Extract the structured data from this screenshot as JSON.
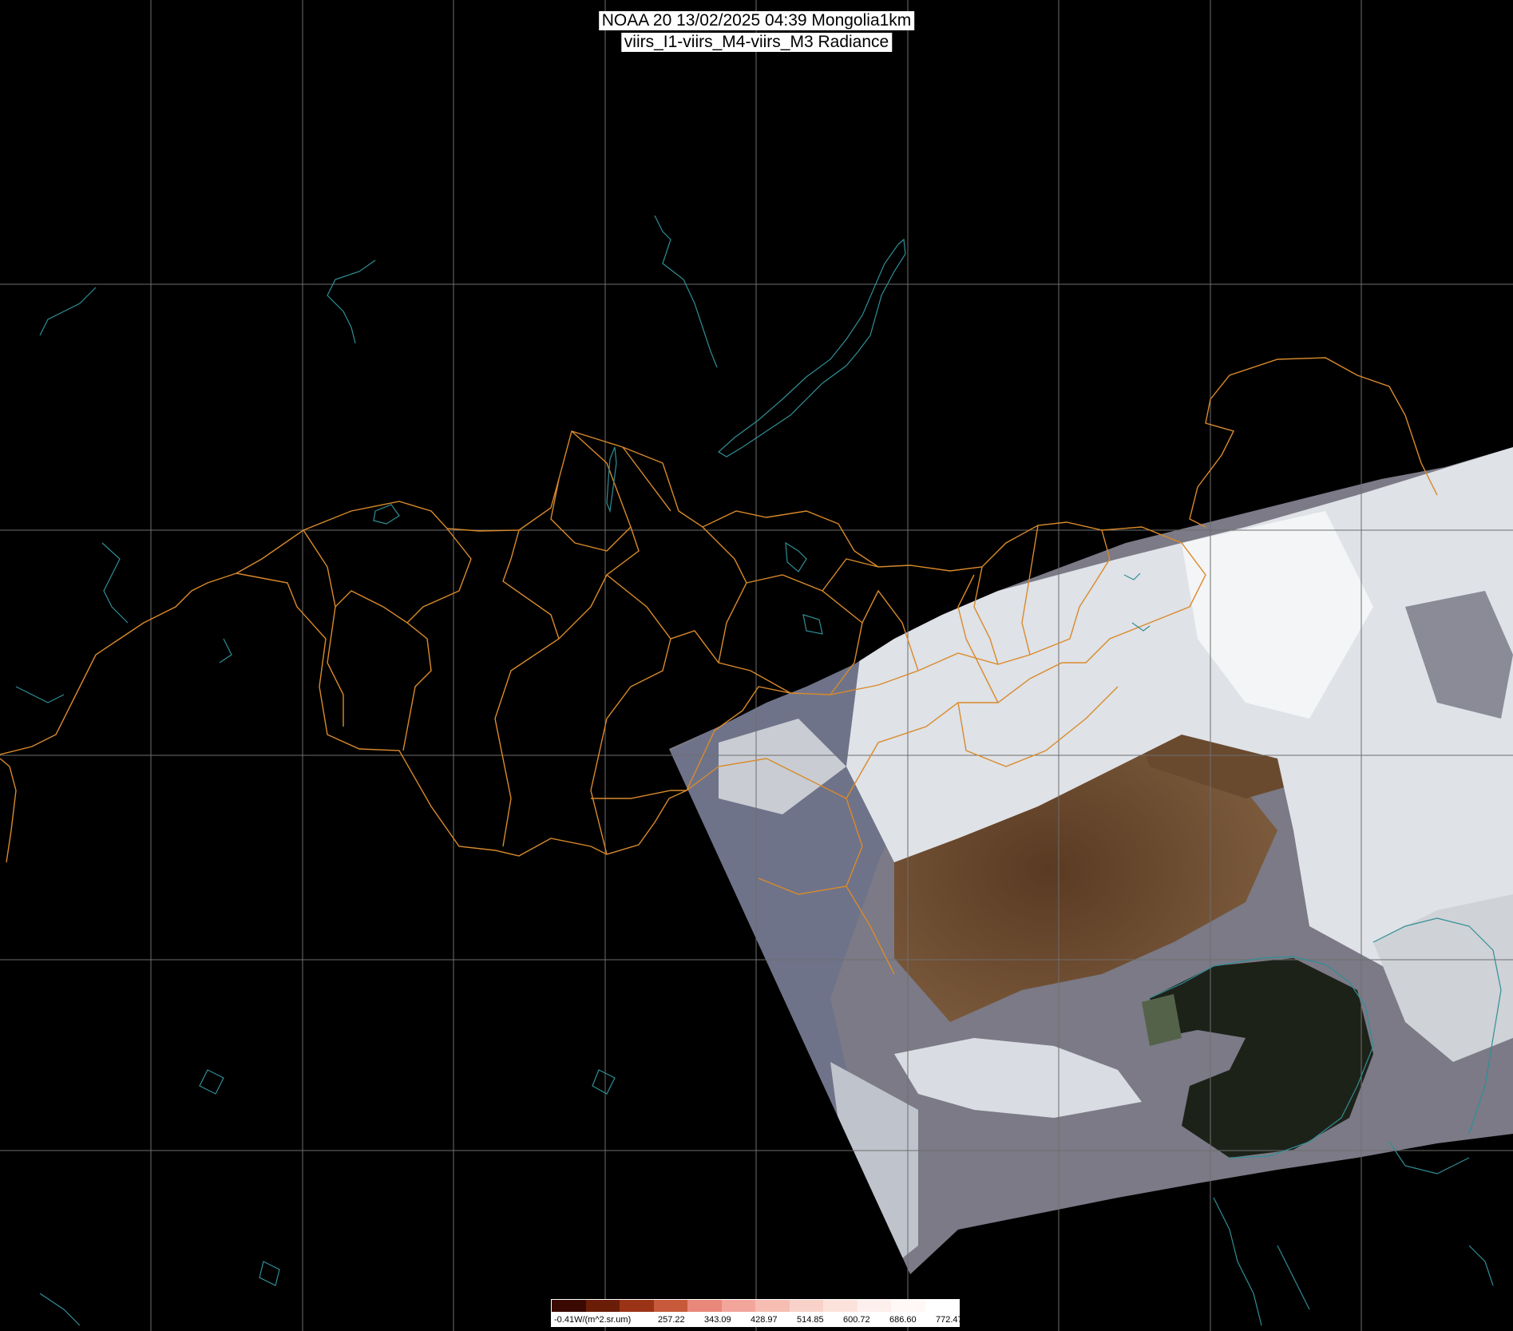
{
  "header": {
    "line1": "NOAA 20 13/02/2025 04:39 Mongolia1km",
    "line2": "viirs_I1-viirs_M4-viirs_M3 Radiance"
  },
  "colors": {
    "background": "#000000",
    "grid": "#6e6e6e",
    "borders": "#d98a2b",
    "coast": "#2f8f97",
    "cloud": "#e8ebef",
    "land_brown": "#6b4a2c",
    "sea": "#1e2419"
  },
  "colorbar": {
    "labels": [
      "-0.41W/(m^2.sr.um)",
      "257.22",
      "343.09",
      "428.97",
      "514.85",
      "600.72",
      "686.60",
      "772.47"
    ],
    "colors": [
      "#3a0a02",
      "#6a1e08",
      "#9b3416",
      "#c75a3a",
      "#e8877a",
      "#f2a59b",
      "#f6bdb3",
      "#f8d2c9",
      "#fbe3dc",
      "#fdf0ec",
      "#fff8f6",
      "#ffffff"
    ]
  },
  "map_features": {
    "graticule": "grid-lines",
    "swath": "satellite-swath-image",
    "lakes": [
      "lake-baikal",
      "khovsgol-lake",
      "uvs-lake"
    ]
  }
}
